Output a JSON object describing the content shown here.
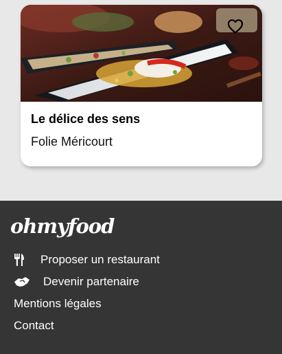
{
  "card": {
    "title": "Le délice des sens",
    "location": "Folie Méricourt",
    "image_icon": "restaurant-dish-photo",
    "favorite_icon": "heart-outline-icon"
  },
  "footer": {
    "logo": "ohmyfood",
    "links": [
      {
        "label": "Proposer un restaurant",
        "icon": "utensils-icon"
      },
      {
        "label": "Devenir partenaire",
        "icon": "handshake-icon"
      },
      {
        "label": "Mentions légales"
      },
      {
        "label": "Contact"
      }
    ]
  },
  "colors": {
    "page_background": "#e8e8e8",
    "footer_background": "#353535",
    "card_background": "#ffffff"
  }
}
